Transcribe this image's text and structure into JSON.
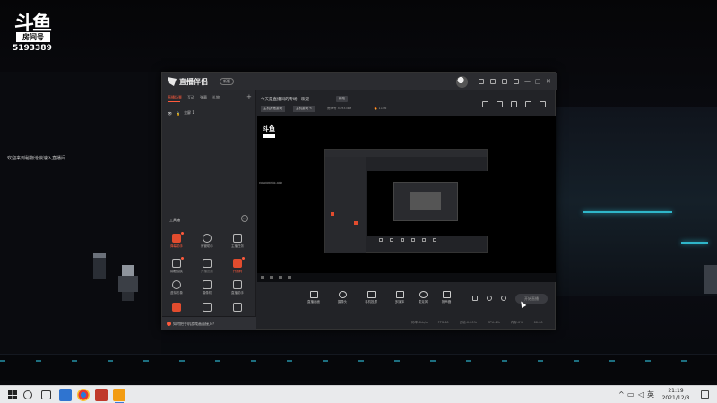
{
  "overlay": {
    "logo_text": "斗鱼",
    "room_label": "房间号",
    "room_id": "5193389",
    "welcome": "欢迎来到秘物沧浪速入直播间"
  },
  "app": {
    "title": "直播伴侣",
    "version_badge": "新版",
    "window_controls": [
      "—",
      "□",
      "✕"
    ],
    "scene_tabs": [
      "直播场景",
      "互动",
      "弹幕",
      "礼物"
    ],
    "scene_add": "+",
    "scene_item": "全屏 1",
    "tools_title": "工具箱",
    "tools_more": "···",
    "tools": [
      {
        "label": "弹幕助手",
        "style": "red",
        "dot": true
      },
      {
        "label": "房管助手",
        "style": "normal",
        "dot": false
      },
      {
        "label": "主播任务",
        "style": "normal",
        "dot": false
      },
      {
        "label": "锦鲤抽奖",
        "style": "normal",
        "dot": true
      },
      {
        "label": "开播回放",
        "style": "dim",
        "dot": false
      },
      {
        "label": "开播码",
        "style": "red",
        "dot": true
      },
      {
        "label": "虚拟形象",
        "style": "normal",
        "dot": false
      },
      {
        "label": "摄像机",
        "style": "normal",
        "dot": false
      },
      {
        "label": "直播助手",
        "style": "normal",
        "dot": false
      },
      {
        "label": "语音连麦",
        "style": "normal",
        "dot": false
      },
      {
        "label": "",
        "style": "normal",
        "dot": false
      },
      {
        "label": "",
        "style": "normal",
        "dot": false
      }
    ],
    "bottom_tip": "如何把手机游戏画面接入？",
    "room_title": "今天是直播间的专场，欢迎",
    "edit_label": "修改",
    "category_tags": [
      "主机其他游戏",
      "主机游戏 ✎"
    ],
    "room_no": "房间号 5193389",
    "hot": "🔥 1156",
    "toolbar": [
      {
        "label": "直播画面",
        "icon": "screen-icon"
      },
      {
        "label": "摄像头",
        "icon": "camera-icon"
      },
      {
        "label": "手机投屏",
        "icon": "phone-cast-icon"
      },
      {
        "label": "多媒体",
        "icon": "media-icon"
      },
      {
        "label": "麦克风",
        "icon": "mic-icon"
      },
      {
        "label": "扬声器",
        "icon": "speaker-icon"
      }
    ],
    "golive_label": "开始直播",
    "status": [
      "码率:0kb/s",
      "FPS:60",
      "丢帧:0.00%",
      "CPU:4%",
      "内存:0%",
      "00:00"
    ]
  },
  "taskbar": {
    "time": "21:19",
    "date": "2021/12/8"
  }
}
